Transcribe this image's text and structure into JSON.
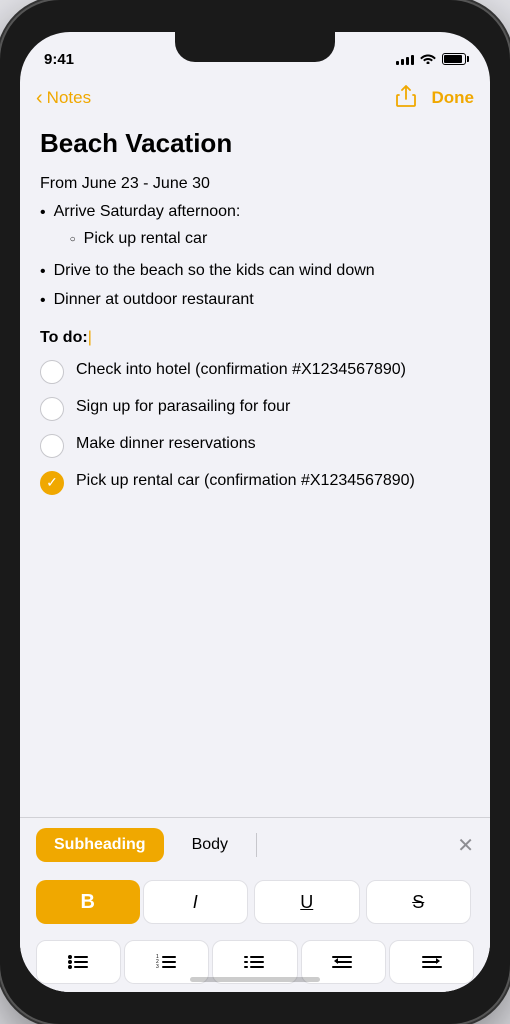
{
  "status": {
    "time": "9:41",
    "signal_bars": [
      4,
      6,
      8,
      10,
      12
    ],
    "battery_label": "battery"
  },
  "nav": {
    "back_label": "Notes",
    "done_label": "Done"
  },
  "note": {
    "title": "Beach Vacation",
    "date": "From June 23 - June 30",
    "bullet_items": [
      {
        "text": "Arrive Saturday afternoon:",
        "sub": [
          "Pick up rental car"
        ]
      },
      {
        "text": "Drive to the beach so the kids can wind down",
        "sub": []
      },
      {
        "text": "Dinner at outdoor restaurant",
        "sub": []
      }
    ],
    "todo_label": "To do:",
    "todo_items": [
      {
        "text": "Check into hotel (confirmation #X1234567890)",
        "checked": false
      },
      {
        "text": "Sign up for parasailing for four",
        "checked": false
      },
      {
        "text": "Make dinner reservations",
        "checked": false
      },
      {
        "text": "Pick up rental car (confirmation #X1234567890)",
        "checked": true
      }
    ]
  },
  "toolbar": {
    "subheading_label": "Subheading",
    "body_label": "Body",
    "close_icon": "✕",
    "bold_label": "B",
    "italic_label": "I",
    "underline_label": "U",
    "strikethrough_label": "S",
    "list_bullet_icon": "≡",
    "list_numbered_icon": "≡",
    "list_dash_icon": "≡",
    "indent_left_icon": "⇐",
    "indent_right_icon": "⇒"
  },
  "colors": {
    "accent": "#f0a800",
    "text_primary": "#000000",
    "text_secondary": "#8e8e93",
    "border": "#d1d1d6"
  }
}
